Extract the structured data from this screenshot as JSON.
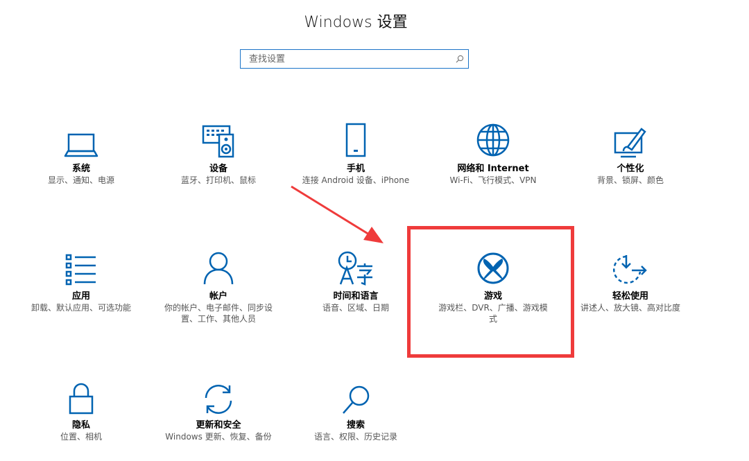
{
  "window": {
    "title": "Windows 设置"
  },
  "search": {
    "placeholder": "查找设置",
    "icon": "search-icon"
  },
  "accent_color": "#0063b1",
  "annotation_color": "#ef3b3b",
  "tiles": [
    {
      "name": "系统",
      "desc": "显示、通知、电源",
      "icon": "laptop-icon"
    },
    {
      "name": "设备",
      "desc": "蓝牙、打印机、鼠标",
      "icon": "keyboard-speaker-icon"
    },
    {
      "name": "手机",
      "desc": "连接 Android 设备、iPhone",
      "icon": "phone-icon"
    },
    {
      "name": "网络和 Internet",
      "desc": "Wi-Fi、飞行模式、VPN",
      "icon": "globe-icon"
    },
    {
      "name": "个性化",
      "desc": "背景、锁屏、颜色",
      "icon": "paint-icon"
    },
    {
      "name": "应用",
      "desc": "卸载、默认应用、可选功能",
      "icon": "list-icon"
    },
    {
      "name": "帐户",
      "desc": "你的帐户、电子邮件、同步设置、工作、其他人员",
      "icon": "person-icon"
    },
    {
      "name": "时间和语言",
      "desc": "语音、区域、日期",
      "icon": "time-language-icon"
    },
    {
      "name": "游戏",
      "desc": "游戏栏、DVR、广播、游戏模式",
      "icon": "xbox-icon"
    },
    {
      "name": "轻松使用",
      "desc": "讲述人、放大镜、高对比度",
      "icon": "ease-of-access-icon"
    },
    {
      "name": "隐私",
      "desc": "位置、相机",
      "icon": "lock-icon"
    },
    {
      "name": "更新和安全",
      "desc": "Windows 更新、恢复、备份",
      "icon": "sync-icon"
    },
    {
      "name": "搜索",
      "desc": "语言、权限、历史记录",
      "icon": "search-icon"
    }
  ]
}
